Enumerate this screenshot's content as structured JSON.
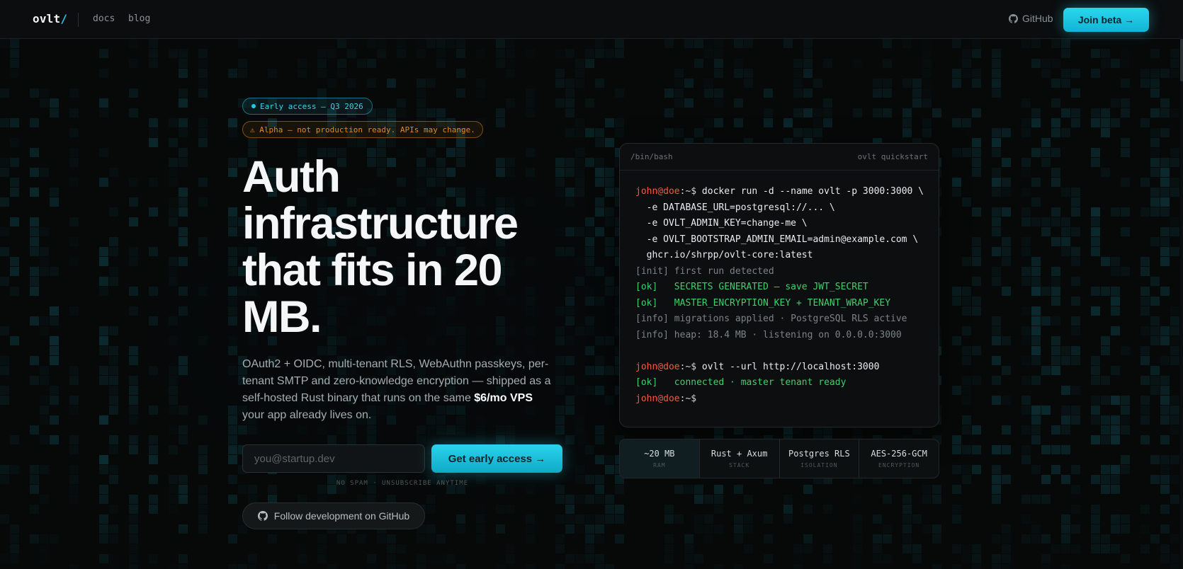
{
  "nav": {
    "logo_text": "ovlt",
    "logo_slash": "/",
    "links": [
      {
        "label": "docs"
      },
      {
        "label": "blog"
      }
    ],
    "github_label": "GitHub",
    "join_label": "Join beta →"
  },
  "hero": {
    "badge_early": "Early access — Q3 2026",
    "badge_alpha": "⚠ Alpha — not production ready. APIs may change.",
    "headline": "Auth infrastructure that fits in 20 MB.",
    "subcopy_before": "OAuth2 + OIDC, multi-tenant RLS, WebAuthn passkeys, per-tenant SMTP and zero-knowledge encryption — shipped as a self-hosted Rust binary that runs on the same ",
    "subcopy_strong": "$6/mo VPS",
    "subcopy_after": " your app already lives on.",
    "email_placeholder": "you@startup.dev",
    "cta_label": "Get early access →",
    "nospam": "NO SPAM · UNSUBSCRIBE ANYTIME",
    "follow_label": "Follow development on GitHub"
  },
  "terminal": {
    "title_left": "/bin/bash",
    "title_right": "ovlt quickstart",
    "prompt_user": "john@doe",
    "prompt_path": ":~$",
    "lines": [
      {
        "kind": "prompt",
        "text": " docker run -d --name ovlt -p 3000:3000 \\"
      },
      {
        "kind": "cmd",
        "text": "  -e DATABASE_URL=postgresql://... \\"
      },
      {
        "kind": "cmd",
        "text": "  -e OVLT_ADMIN_KEY=change-me \\"
      },
      {
        "kind": "cmd",
        "text": "  -e OVLT_BOOTSTRAP_ADMIN_EMAIL=admin@example.com \\"
      },
      {
        "kind": "cmd",
        "text": "  ghcr.io/shrpp/ovlt-core:latest"
      },
      {
        "kind": "info",
        "text": "[init] first run detected"
      },
      {
        "kind": "ok",
        "text": "[ok]   SECRETS GENERATED — save JWT_SECRET"
      },
      {
        "kind": "ok",
        "text": "[ok]   MASTER_ENCRYPTION_KEY + TENANT_WRAP_KEY"
      },
      {
        "kind": "info",
        "text": "[info] migrations applied · PostgreSQL RLS active"
      },
      {
        "kind": "info",
        "text": "[info] heap: 18.4 MB · listening on 0.0.0.0:3000"
      },
      {
        "kind": "gap",
        "text": ""
      },
      {
        "kind": "prompt",
        "text": " ovlt --url http://localhost:3000"
      },
      {
        "kind": "ok",
        "text": "[ok]   connected · master tenant ready"
      },
      {
        "kind": "prompt",
        "text": ""
      }
    ]
  },
  "stats": [
    {
      "value": "~20 MB",
      "label": "RAM",
      "active": true
    },
    {
      "value": "Rust + Axum",
      "label": "STACK",
      "active": false
    },
    {
      "value": "Postgres RLS",
      "label": "ISOLATION",
      "active": false
    },
    {
      "value": "AES-256-GCM",
      "label": "ENCRYPTION",
      "active": false
    }
  ],
  "colors": {
    "accent": "#22c8e4",
    "warning": "#dd8a28",
    "ok": "#3fcf6c",
    "prompt_user": "#ee5a45",
    "background": "#070909"
  }
}
